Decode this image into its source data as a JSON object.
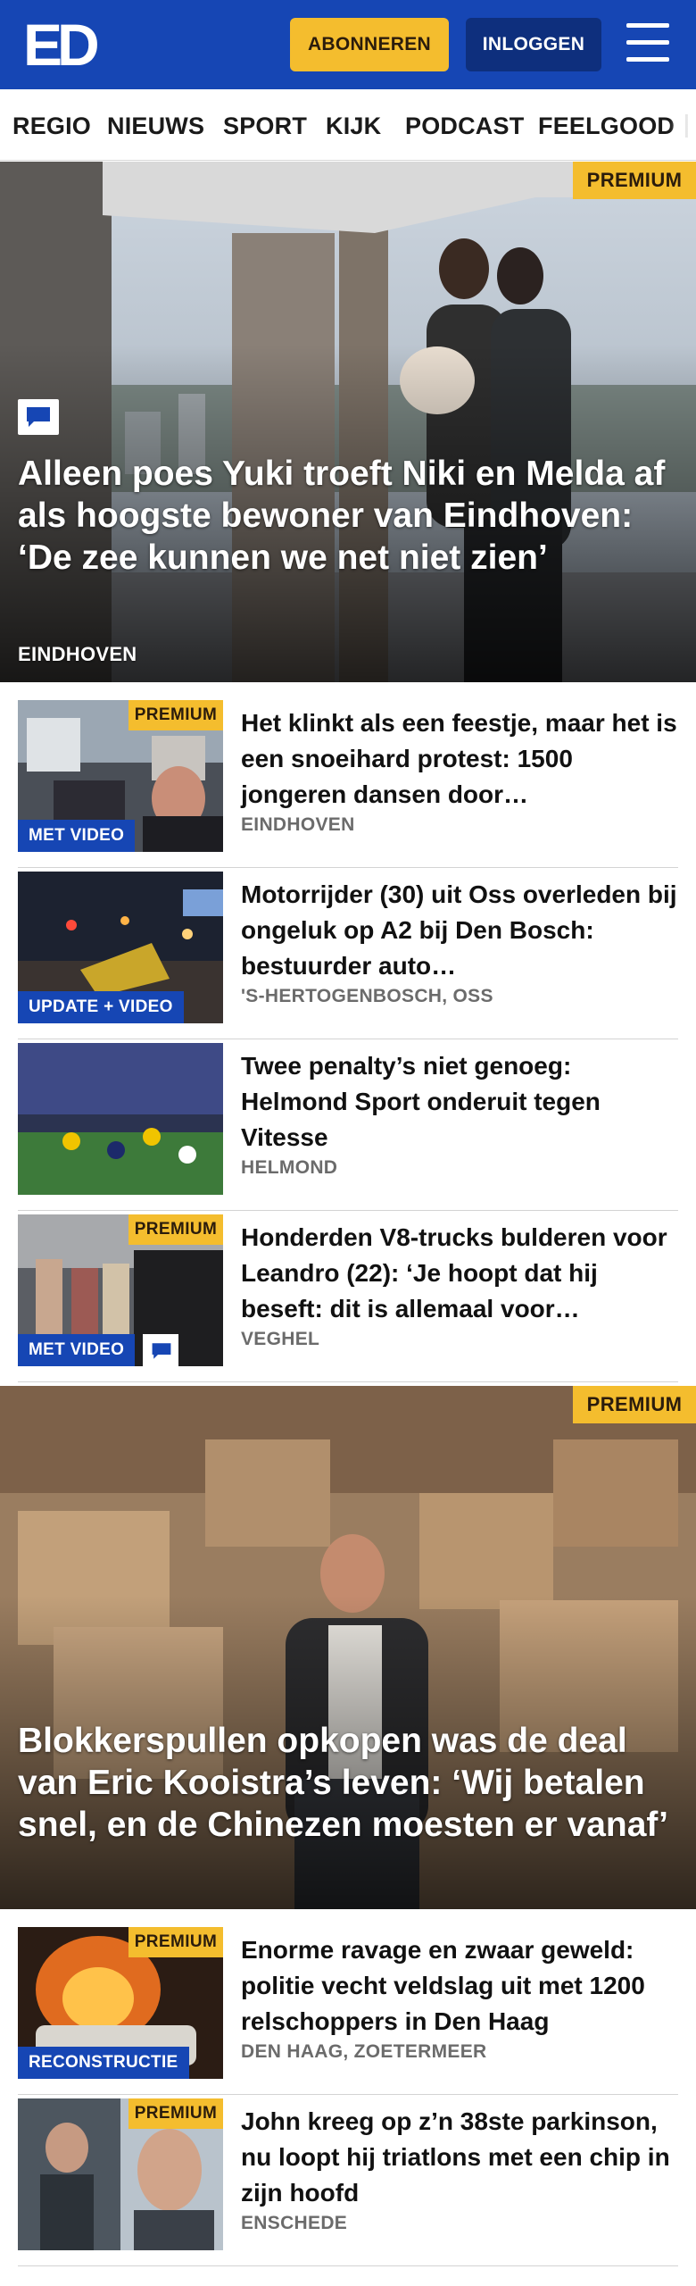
{
  "header": {
    "logo_text": "ED",
    "subscribe_label": "ABONNEREN",
    "login_label": "INLOGGEN",
    "menu_icon": "hamburger-menu-icon"
  },
  "nav": {
    "items": [
      "REGIO",
      "NIEUWS",
      "SPORT",
      "KIJK",
      "PODCAST",
      "FEELGOOD"
    ]
  },
  "hero1": {
    "premium": "PREMIUM",
    "title": "Alleen poes Yuki troeft Niki en Melda af als hoogste bewoner van Eindhoven: ‘De zee kunnen we net niet zien’",
    "category": "EINDHOVEN",
    "has_comments": true
  },
  "articles_top": [
    {
      "premium": "PREMIUM",
      "label": "MET VIDEO",
      "title": "Het klinkt als een feestje, maar het is een snoeihard protest: 1500 jongeren dansen door…",
      "location": "EINDHOVEN"
    },
    {
      "label": "UPDATE + VIDEO",
      "title": "Motorrijder (30) uit Oss overleden bij ongeluk op A2 bij Den Bosch: bestuurder auto…",
      "location": "'S-HERTOGENBOSCH, OSS"
    },
    {
      "title": "Twee penalty’s niet genoeg: Helmond Sport onderuit tegen Vitesse",
      "location": "HELMOND"
    },
    {
      "premium": "PREMIUM",
      "label": "MET VIDEO",
      "title": "Honderden V8-trucks bulderen voor Leandro (22): ‘Je hoopt dat hij beseft: dit is allemaal voor…",
      "location": "VEGHEL"
    }
  ],
  "hero2": {
    "premium": "PREMIUM",
    "title": "Blokkerspullen opkopen was de deal van Eric Kooistra’s leven: ‘Wij betalen snel, en de Chinezen moesten er vanaf’"
  },
  "articles_bottom": [
    {
      "premium": "PREMIUM",
      "label": "RECONSTRUCTIE",
      "title": "Enorme ravage en zwaar geweld: politie vecht veldslag uit met 1200 relschoppers in Den Haag",
      "location": "DEN HAAG, ZOETERMEER"
    },
    {
      "premium": "PREMIUM",
      "title": "John kreeg op z’n 38ste parkinson, nu loopt hij triatlons met een chip in zijn hoofd",
      "location": "ENSCHEDE"
    }
  ],
  "colors": {
    "brand_blue": "#1646b4",
    "dark_blue": "#0e2f7d",
    "premium_yellow": "#f4bd2e"
  }
}
